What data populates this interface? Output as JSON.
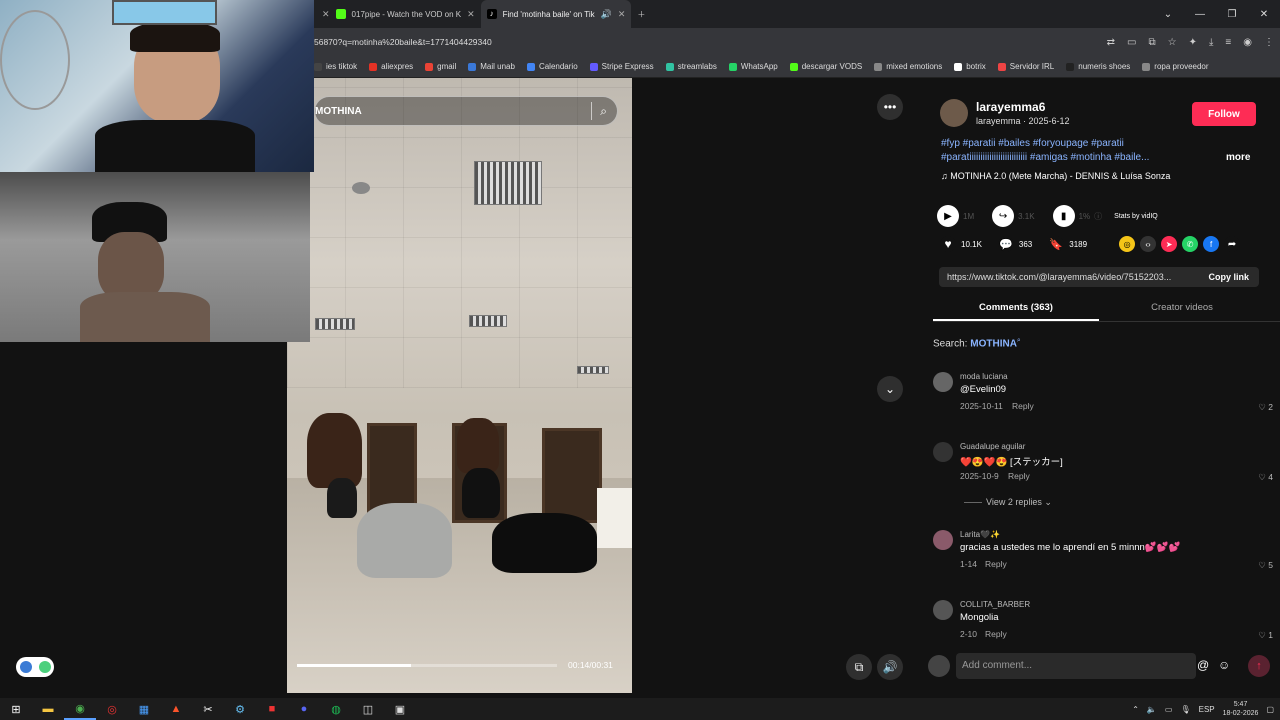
{
  "tabs": [
    {
      "label": "017pipe - Watch the VOD on K"
    },
    {
      "label": "Find 'motinha baile' on Tik"
    }
  ],
  "url": "56870?q=motinha%20baile&t=1771404429340",
  "bookmarks": [
    {
      "label": "ies tiktok",
      "color": "#444"
    },
    {
      "label": "aliexpres",
      "color": "#e43225"
    },
    {
      "label": "gmail",
      "color": "#ea4335"
    },
    {
      "label": "Mail unab",
      "color": "#3a78d8"
    },
    {
      "label": "Calendario",
      "color": "#4285f4"
    },
    {
      "label": "Stripe Express",
      "color": "#635bff"
    },
    {
      "label": "streamlabs",
      "color": "#31c3a2"
    },
    {
      "label": "WhatsApp",
      "color": "#25d366"
    },
    {
      "label": "descargar VODS",
      "color": "#53fc18"
    },
    {
      "label": "mixed emotions",
      "color": "#888"
    },
    {
      "label": "botrix",
      "color": "#fff"
    },
    {
      "label": "Servidor IRL",
      "color": "#e44"
    },
    {
      "label": "numeris shoes",
      "color": "#222"
    },
    {
      "label": "ropa proveedor",
      "color": "#888"
    }
  ],
  "search": {
    "query": "MOTHINA"
  },
  "video": {
    "time": "00:14/00:31",
    "progress": 0.44
  },
  "author": {
    "name": "larayemma6",
    "handle_date": "larayemma · 2025-6-12",
    "follow": "Follow"
  },
  "description": {
    "line1": "#fyp #paratii #bailes #foryoupage #paratii",
    "line2": "#paratiiiiiiiiiiiiiiiiiiiiiiiiii #amigas #motinha #baile...",
    "more": "more"
  },
  "music": "MOTINHA 2.0 (Mete Marcha) - DENNIS & Luísa Sonza",
  "stats": {
    "plays": "1M",
    "shares": "3.1K",
    "pct": "1%",
    "vidiq": "Stats by vidIQ",
    "likes": "10.1K",
    "comments": "363",
    "saves": "3189"
  },
  "link": {
    "url": "https://www.tiktok.com/@larayemma6/video/75152203...",
    "copy": "Copy link"
  },
  "panel_tabs": {
    "comments": "Comments (363)",
    "creator": "Creator videos"
  },
  "search_label": {
    "prefix": "Search:",
    "term": "MOTHINA"
  },
  "comments": [
    {
      "user": "moda luciana",
      "text": "@Evelin09",
      "date": "2025-10-11",
      "reply": "Reply",
      "likes": "2",
      "color": "#666"
    },
    {
      "user": "Guadalupe aguilar",
      "text": "❤️😍❤️😍 [ステッカー]",
      "date": "2025-10-9",
      "reply": "Reply",
      "likes": "4",
      "color": "#333"
    },
    {
      "user": "Larita🖤✨",
      "text": "gracias a ustedes me lo aprendí en 5 minnn💕💕💕",
      "date": "1-14",
      "reply": "Reply",
      "likes": "5",
      "color": "#8a5a6a"
    },
    {
      "user": "COLLITA_BARBER",
      "text": "Mongolia",
      "date": "2-10",
      "reply": "Reply",
      "likes": "1",
      "color": "#555"
    }
  ],
  "view_replies": "View 2 replies",
  "add_comment": "Add comment...",
  "taskbar": {
    "time": "5:47",
    "date": "18-02-2026",
    "lang": "ESP"
  }
}
